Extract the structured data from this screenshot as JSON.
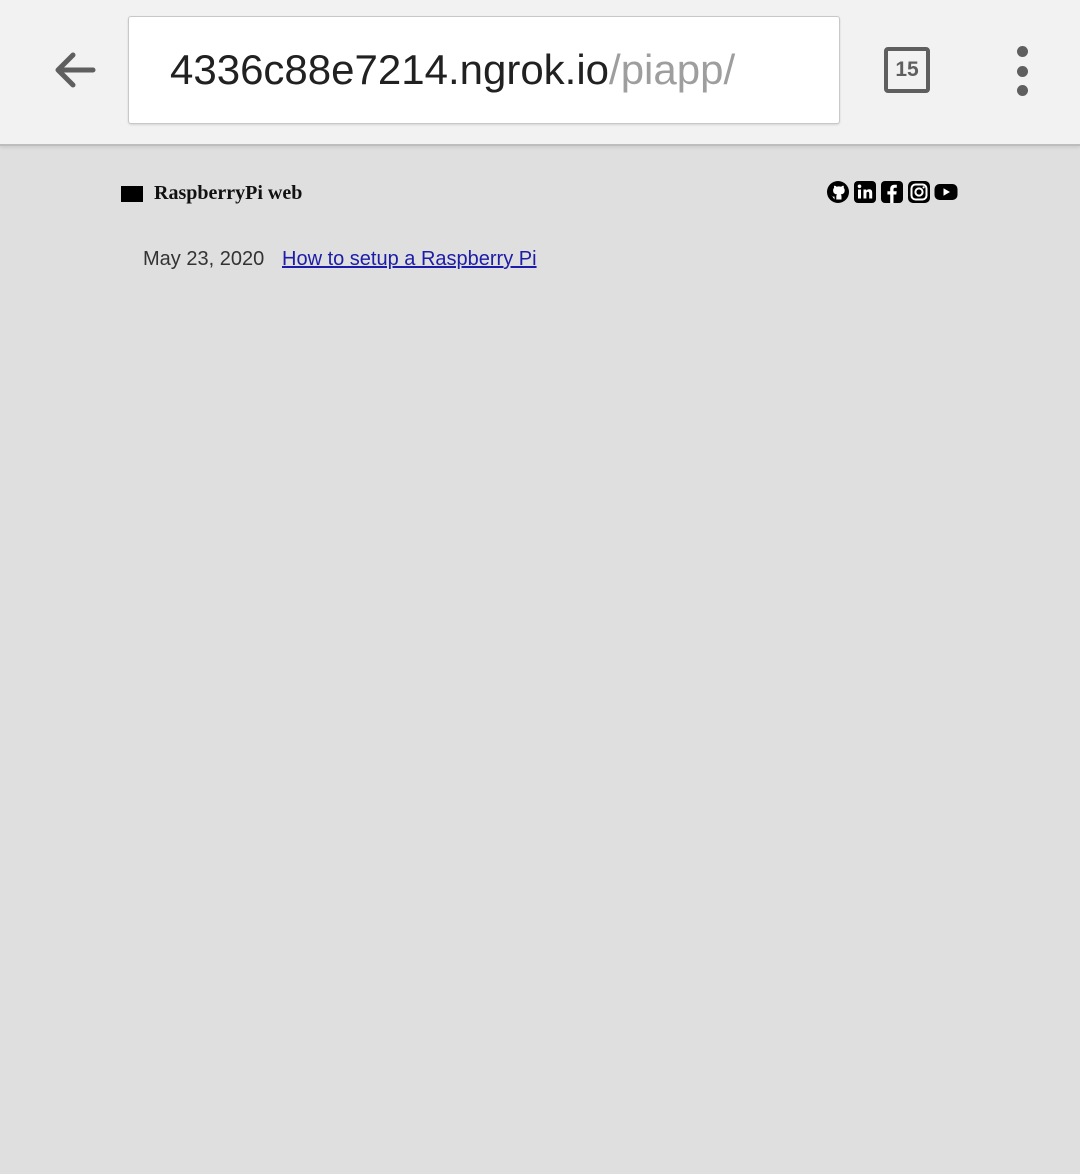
{
  "browser": {
    "url_host": "4336c88e7214.ngrok.io",
    "url_path": "/piapp/",
    "tab_count": "15",
    "icons": [
      "back-arrow-icon",
      "tabs-icon",
      "more-vert-icon"
    ]
  },
  "site": {
    "name": "RaspberryPi web",
    "social_icons": [
      "github-icon",
      "linkedin-icon",
      "facebook-icon",
      "instagram-icon",
      "youtube-icon"
    ]
  },
  "posts": [
    {
      "date": "May 23, 2020",
      "title": "How to setup a Raspberry Pi"
    }
  ],
  "colors": {
    "page_background": "#dfdfdf",
    "toolbar_background": "#f2f2f2",
    "link": "#1c1ca8"
  }
}
